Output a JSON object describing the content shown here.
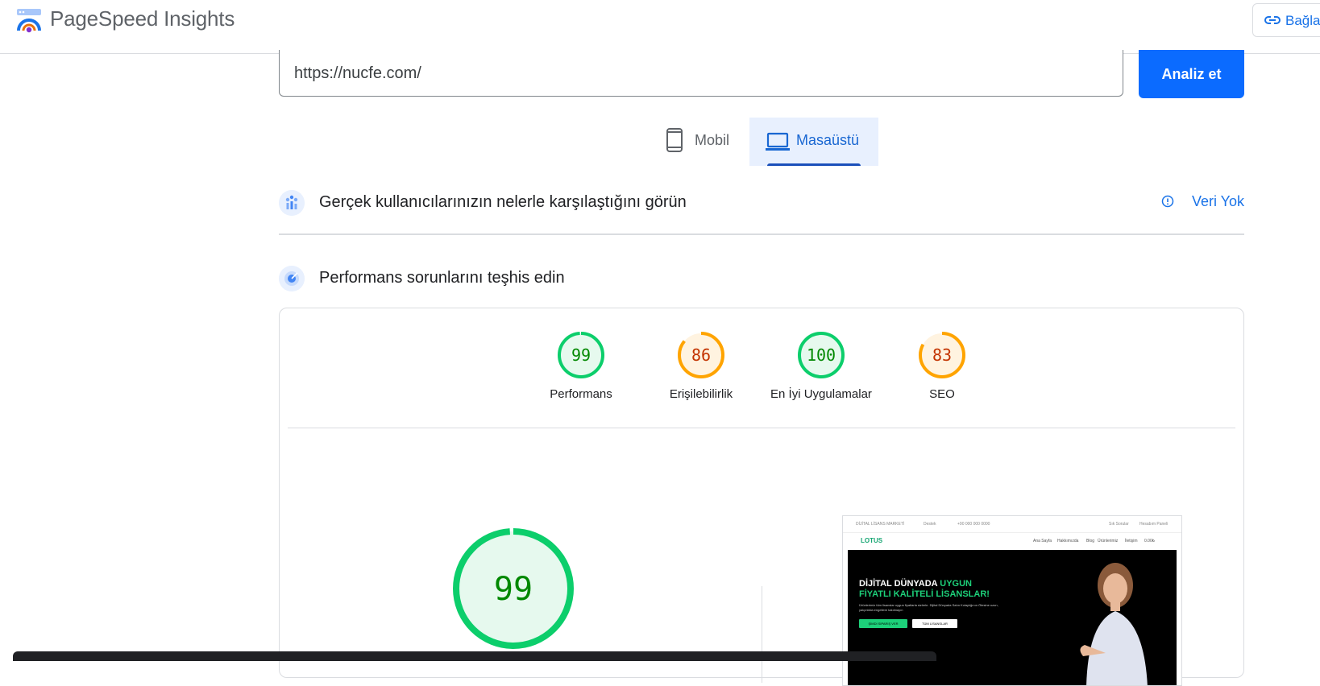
{
  "header": {
    "app_title": "PageSpeed Insights",
    "share_label": "Bağla"
  },
  "search": {
    "url_value": "https://nucfe.com/",
    "analyze_label": "Analiz et"
  },
  "device_tabs": [
    {
      "label": "Mobil",
      "selected": false
    },
    {
      "label": "Masaüstü",
      "selected": true
    }
  ],
  "crux": {
    "title": "Gerçek kullanıcılarınızın nelerle karşılaştığını görün",
    "status": "Veri Yok"
  },
  "lab": {
    "title": "Performans sorunlarını teşhis edin"
  },
  "scores": [
    {
      "label": "Performans",
      "value": "99",
      "color": "#0cce6b",
      "text_color": "#008800",
      "fill": "#e6f9ee"
    },
    {
      "label": "Erişilebilirlik",
      "value": "86",
      "color": "#ffa400",
      "text_color": "#c33300",
      "fill": "#fff3e0"
    },
    {
      "label": "En İyi Uygulamalar",
      "value": "100",
      "color": "#0cce6b",
      "text_color": "#008800",
      "fill": "#e6f9ee"
    },
    {
      "label": "SEO",
      "value": "83",
      "color": "#ffa400",
      "text_color": "#c33300",
      "fill": "#fff3e0"
    }
  ],
  "main_score": {
    "value": "99",
    "color": "#0cce6b",
    "text_color": "#008800"
  },
  "screenshot": {
    "topbar_left": "DİJİTAL LİSANS MARKETİ",
    "topbar_mid1": "Destek",
    "topbar_mid2": "+90 000 000 0000",
    "topbar_right1": "Sık Sorular",
    "topbar_right2": "Hesabım Paneli",
    "logo": "LOTUS",
    "nav": [
      "Ana Sayfa",
      "Hakkımızda",
      "Blog",
      "Ürünlerimiz",
      "İletişim",
      "0.00₺"
    ],
    "hero_line1": "DİJİTAL DÜNYADA ",
    "hero_line1_accent": "UYGUN",
    "hero_line2": "FİYATLI KALİTELİ LİSANSLAR!",
    "hero_text": "Ürünlerimiz tüm lisanslar uygun fiyatlarla sizlerle. Dijital Dünyada Satın Kolaylığının Ötesine uzun, yalçınlıkla engellere takılmayın",
    "btn1": "ŞİMDİ SİPARİŞ VER",
    "btn2": "TÜM LİSANSLAR"
  }
}
